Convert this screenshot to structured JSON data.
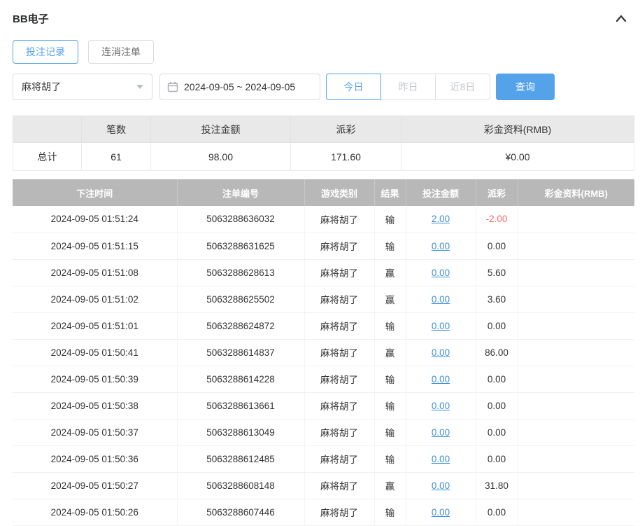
{
  "header": {
    "title": "BB电子"
  },
  "tabs": [
    {
      "label": "投注记录",
      "active": true
    },
    {
      "label": "连消注单",
      "active": false
    }
  ],
  "filters": {
    "game_select": {
      "value": "麻将胡了"
    },
    "date_range": {
      "value": "2024-09-05 ~ 2024-09-05"
    },
    "quick_buttons": [
      {
        "label": "今日",
        "active": true
      },
      {
        "label": "昨日",
        "active": false
      },
      {
        "label": "近8日",
        "active": false
      }
    ],
    "search_button": "查询"
  },
  "summary": {
    "headers": [
      "",
      "笔数",
      "投注金额",
      "派彩",
      "彩金资料(RMB)"
    ],
    "row": {
      "label": "总计",
      "count": "61",
      "bet_amount": "98.00",
      "payout": "171.60",
      "bonus": "¥0.00"
    }
  },
  "table": {
    "headers": [
      "下注时间",
      "注单编号",
      "游戏类别",
      "结果",
      "投注金额",
      "派彩",
      "彩金资料(RMB)"
    ],
    "rows": [
      {
        "time": "2024-09-05 01:51:24",
        "order_id": "5063288636032",
        "game": "麻将胡了",
        "result": "输",
        "bet": "2.00",
        "payout": "-2.00",
        "bonus": ""
      },
      {
        "time": "2024-09-05 01:51:15",
        "order_id": "5063288631625",
        "game": "麻将胡了",
        "result": "输",
        "bet": "0.00",
        "payout": "0.00",
        "bonus": ""
      },
      {
        "time": "2024-09-05 01:51:08",
        "order_id": "5063288628613",
        "game": "麻将胡了",
        "result": "赢",
        "bet": "0.00",
        "payout": "5.60",
        "bonus": ""
      },
      {
        "time": "2024-09-05 01:51:02",
        "order_id": "5063288625502",
        "game": "麻将胡了",
        "result": "赢",
        "bet": "0.00",
        "payout": "3.60",
        "bonus": ""
      },
      {
        "time": "2024-09-05 01:51:01",
        "order_id": "5063288624872",
        "game": "麻将胡了",
        "result": "输",
        "bet": "0.00",
        "payout": "0.00",
        "bonus": ""
      },
      {
        "time": "2024-09-05 01:50:41",
        "order_id": "5063288614837",
        "game": "麻将胡了",
        "result": "赢",
        "bet": "0.00",
        "payout": "86.00",
        "bonus": ""
      },
      {
        "time": "2024-09-05 01:50:39",
        "order_id": "5063288614228",
        "game": "麻将胡了",
        "result": "输",
        "bet": "0.00",
        "payout": "0.00",
        "bonus": ""
      },
      {
        "time": "2024-09-05 01:50:38",
        "order_id": "5063288613661",
        "game": "麻将胡了",
        "result": "输",
        "bet": "0.00",
        "payout": "0.00",
        "bonus": ""
      },
      {
        "time": "2024-09-05 01:50:37",
        "order_id": "5063288613049",
        "game": "麻将胡了",
        "result": "输",
        "bet": "0.00",
        "payout": "0.00",
        "bonus": ""
      },
      {
        "time": "2024-09-05 01:50:36",
        "order_id": "5063288612485",
        "game": "麻将胡了",
        "result": "输",
        "bet": "0.00",
        "payout": "0.00",
        "bonus": ""
      },
      {
        "time": "2024-09-05 01:50:27",
        "order_id": "5063288608148",
        "game": "麻将胡了",
        "result": "赢",
        "bet": "0.00",
        "payout": "31.80",
        "bonus": ""
      },
      {
        "time": "2024-09-05 01:50:26",
        "order_id": "5063288607446",
        "game": "麻将胡了",
        "result": "输",
        "bet": "0.00",
        "payout": "0.00",
        "bonus": ""
      }
    ]
  },
  "colors": {
    "accent": "#54a3ea",
    "link": "#3e8fd8",
    "negative": "#f56c6c",
    "table_header": "#b8b8b8"
  }
}
